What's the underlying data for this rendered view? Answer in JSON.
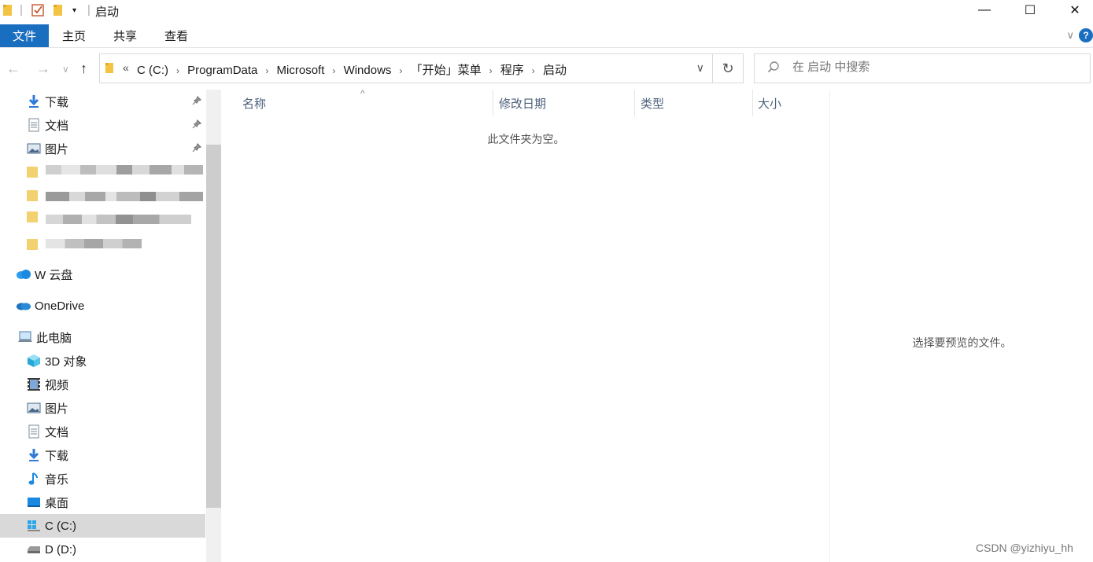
{
  "window": {
    "title": "启动",
    "controls": {
      "minimize": "—",
      "maximize": "☐",
      "close": "✕"
    }
  },
  "ribbon": {
    "tabs": [
      {
        "label": "文件",
        "active": true
      },
      {
        "label": "主页",
        "active": false
      },
      {
        "label": "共享",
        "active": false
      },
      {
        "label": "查看",
        "active": false
      }
    ],
    "help": "?",
    "collapse": "∨"
  },
  "nav": {
    "back": "←",
    "forward": "→",
    "recent": "∨",
    "up": "↑",
    "overflow": "«",
    "breadcrumbs": [
      "C (C:)",
      "ProgramData",
      "Microsoft",
      "Windows",
      "「开始」菜单",
      "程序",
      "启动"
    ],
    "separator": "›",
    "dropdown": "∨",
    "refresh": "↻"
  },
  "search": {
    "placeholder": "在 启动 中搜索"
  },
  "sidebar": {
    "quick_access": [
      {
        "label": "下载",
        "icon": "download-icon",
        "pinned": true
      },
      {
        "label": "文档",
        "icon": "document-icon",
        "pinned": true
      },
      {
        "label": "图片",
        "icon": "picture-icon",
        "pinned": true
      }
    ],
    "cloud": [
      {
        "label": "W   云盘",
        "icon": "cloud-icon"
      },
      {
        "label": "OneDrive",
        "icon": "onedrive-icon"
      }
    ],
    "this_pc": {
      "label": "此电脑",
      "icon": "computer-icon"
    },
    "pc_items": [
      {
        "label": "3D 对象",
        "icon": "3d-objects-icon"
      },
      {
        "label": "视频",
        "icon": "video-icon"
      },
      {
        "label": "图片",
        "icon": "picture-icon"
      },
      {
        "label": "文档",
        "icon": "document-icon"
      },
      {
        "label": "下载",
        "icon": "download-icon"
      },
      {
        "label": "音乐",
        "icon": "music-icon"
      },
      {
        "label": "桌面",
        "icon": "desktop-icon"
      },
      {
        "label": "C (C:)",
        "icon": "windows-drive-icon",
        "selected": true
      },
      {
        "label": "D (D:)",
        "icon": "drive-icon"
      }
    ],
    "pin_glyph": "📌"
  },
  "columns": [
    "名称",
    "修改日期",
    "类型",
    "大小"
  ],
  "sort_caret": "^",
  "empty_message": "此文件夹为空。",
  "preview_message": "选择要预览的文件。",
  "watermark": "CSDN @yizhiyu_hh",
  "colors": {
    "accent": "#1a6ec0",
    "selected": "#d9d9d9",
    "header_text": "#4c607a"
  }
}
